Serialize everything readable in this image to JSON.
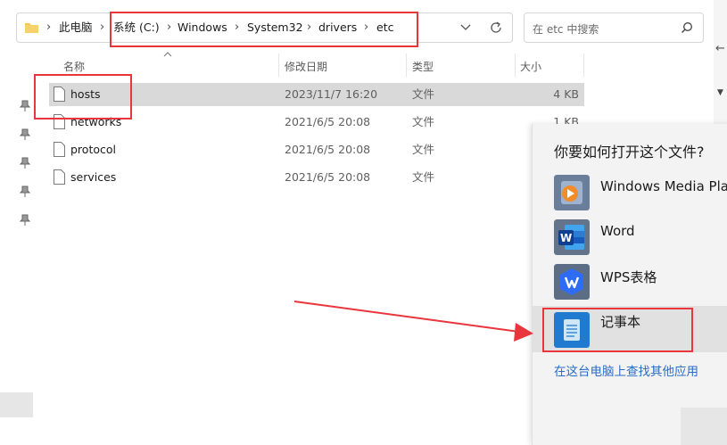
{
  "address_bar": {
    "crumbs": [
      "此电脑",
      "系统 (C:)",
      "Windows",
      "System32",
      "drivers",
      "etc"
    ],
    "icons": [
      "folder-icon",
      "chevron-right-icon",
      "chevron-down-icon",
      "refresh-icon"
    ]
  },
  "search": {
    "placeholder": "在 etc 中搜索",
    "icon": "search-icon"
  },
  "columns": {
    "name": "名称",
    "date": "修改日期",
    "type": "类型",
    "size": "大小"
  },
  "files": [
    {
      "name": "hosts",
      "date": "2023/11/7 16:20",
      "type": "文件",
      "size": "4 KB",
      "selected": true
    },
    {
      "name": "networks",
      "date": "2021/6/5 20:08",
      "type": "文件",
      "size": "1 KB",
      "selected": false
    },
    {
      "name": "protocol",
      "date": "2021/6/5 20:08",
      "type": "文件",
      "size": "",
      "selected": false
    },
    {
      "name": "services",
      "date": "2021/6/5 20:08",
      "type": "文件",
      "size": "",
      "selected": false
    }
  ],
  "open_with": {
    "title": "你要如何打开这个文件?",
    "apps": [
      {
        "name": "Windows Media Player",
        "icon": "windows-media-player-icon"
      },
      {
        "name": "Word",
        "icon": "word-icon"
      },
      {
        "name": "WPS表格",
        "icon": "wps-spreadsheet-icon"
      },
      {
        "name": "记事本",
        "icon": "notepad-icon",
        "highlighted": true
      }
    ],
    "more_link": "在这台电脑上查找其他应用"
  },
  "colors": {
    "annotation_red": "#e8363c",
    "link_blue": "#2b6cc4",
    "selection_gray": "#d9d9d9"
  }
}
